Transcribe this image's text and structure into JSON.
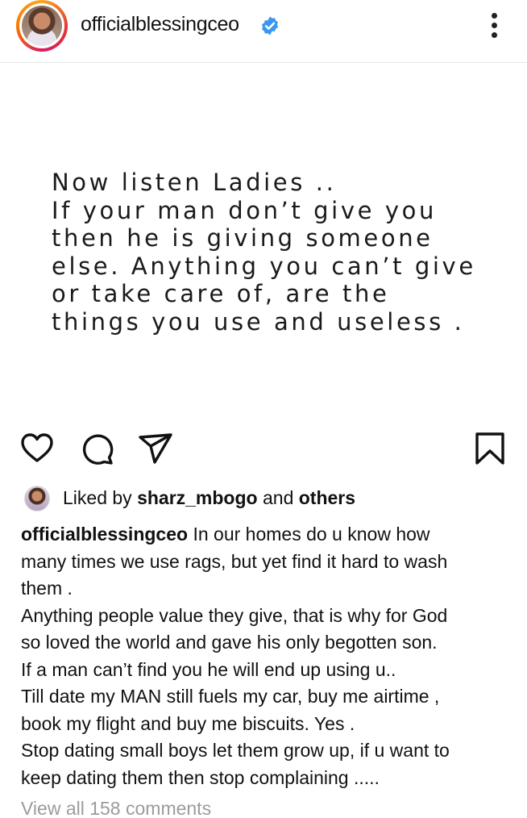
{
  "header": {
    "username": "officialblessingceo",
    "verified": true
  },
  "post": {
    "quote_lines": [
      "Now listen Ladies ..",
      "If your man don’t give you",
      "then he is giving someone",
      "else. Anything you can’t give",
      "or take care of, are the",
      "things you use and useless ."
    ]
  },
  "actions": {
    "icons": [
      "heart-icon",
      "comment-icon",
      "share-icon",
      "bookmark-icon"
    ]
  },
  "likes": {
    "prefix": "Liked by",
    "user": "sharz_mbogo",
    "conjunction": "and",
    "others": "others"
  },
  "caption": {
    "username": "officialblessingceo",
    "first_line_text": "In our homes do u know how",
    "lines": [
      "many times we use rags, but yet find it hard to wash",
      "them .",
      "Anything people value they give, that is why for God",
      "so loved the world and gave his only begotten son.",
      "If a man can’t find you he will end up using u..",
      "Till date my MAN still fuels my car, buy me airtime ,",
      "book my flight and buy me biscuits. Yes .",
      "Stop dating small boys let them grow up, if u want to",
      "keep dating them then stop complaining ....."
    ]
  },
  "comments": {
    "view_all": "View all 158 comments"
  },
  "colors": {
    "verified_blue": "#3897f0",
    "muted_text": "#9b9b9b"
  }
}
